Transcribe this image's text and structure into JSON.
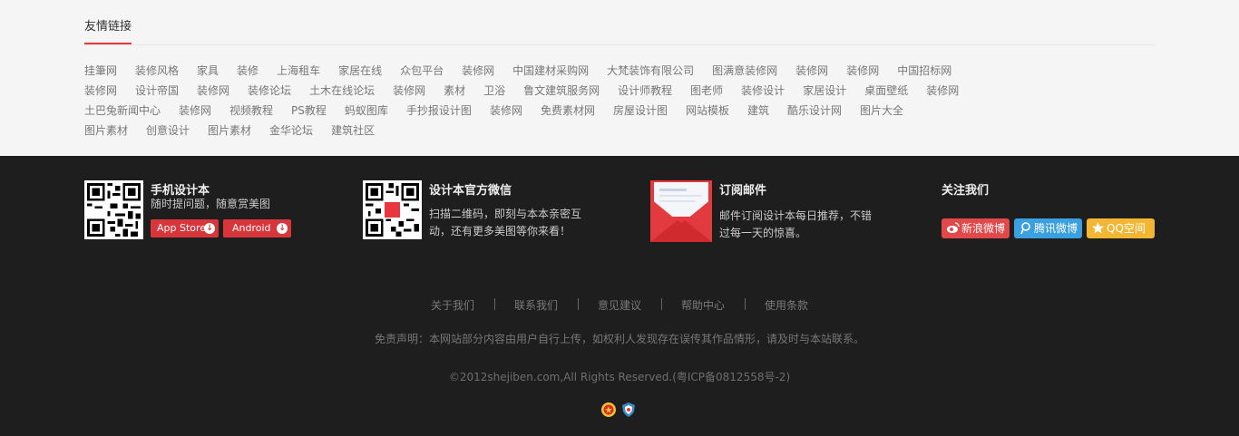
{
  "friend_links": {
    "title": "友情链接",
    "rows": [
      [
        "挂筆网",
        "装修风格",
        "家具",
        "装修",
        "上海租车",
        "家居在线",
        "众包平台",
        "装修网",
        "中国建材采购网",
        "大梵装饰有限公司",
        "图满意装修网",
        "装修网",
        "装修网",
        "中国招标网"
      ],
      [
        "装修网",
        "设计帝国",
        "装修网",
        "装修论坛",
        "土木在线论坛",
        "装修网",
        "素材",
        "卫浴",
        "鲁文建筑服务网",
        "设计师教程",
        "图老师",
        "装修设计",
        "家居设计",
        "桌面壁纸",
        "装修网"
      ],
      [
        "土巴兔新闻中心",
        "装修网",
        "视频教程",
        "PS教程",
        "蚂蚁图库",
        "手抄报设计图",
        "装修网",
        "免费素材网",
        "房屋设计图",
        "网站模板",
        "建筑",
        "酷乐设计网",
        "图片大全"
      ],
      [
        "图片素材",
        "创意设计",
        "图片素材",
        "金华论坛",
        "建筑社区"
      ]
    ]
  },
  "mobile": {
    "title": "手机设计本",
    "desc": "随时提问题，随意赏美图",
    "app_store": "App Store",
    "android": "Android"
  },
  "wechat": {
    "title": "设计本官方微信",
    "desc_line1": "扫描二维码，即刻与本本亲密互",
    "desc_line2": "动，还有更多美图等你来看！"
  },
  "email": {
    "title": "订阅邮件",
    "desc_line1": "邮件订阅设计本每日推荐，不错",
    "desc_line2": "过每一天的惊喜。"
  },
  "follow": {
    "title": "关注我们",
    "buttons": [
      {
        "label": "新浪微博",
        "color": "#e2474a",
        "icon": "weibo-icon"
      },
      {
        "label": "腾讯微博",
        "color": "#3aa0e0",
        "icon": "tencent-weibo-icon"
      },
      {
        "label": "QQ空间",
        "color": "#f2b632",
        "icon": "star-icon"
      }
    ]
  },
  "footer_nav": [
    "关于我们",
    "联系我们",
    "意见建议",
    "帮助中心",
    "使用条款"
  ],
  "disclaimer": "免责声明：本网站部分内容由用户自行上传，如权利人发现存在误传其作品情形，请及时与本站联系。",
  "copyright": "©2012shejiben.com,All Rights Reserved.(粤ICP备0812558号-2)"
}
